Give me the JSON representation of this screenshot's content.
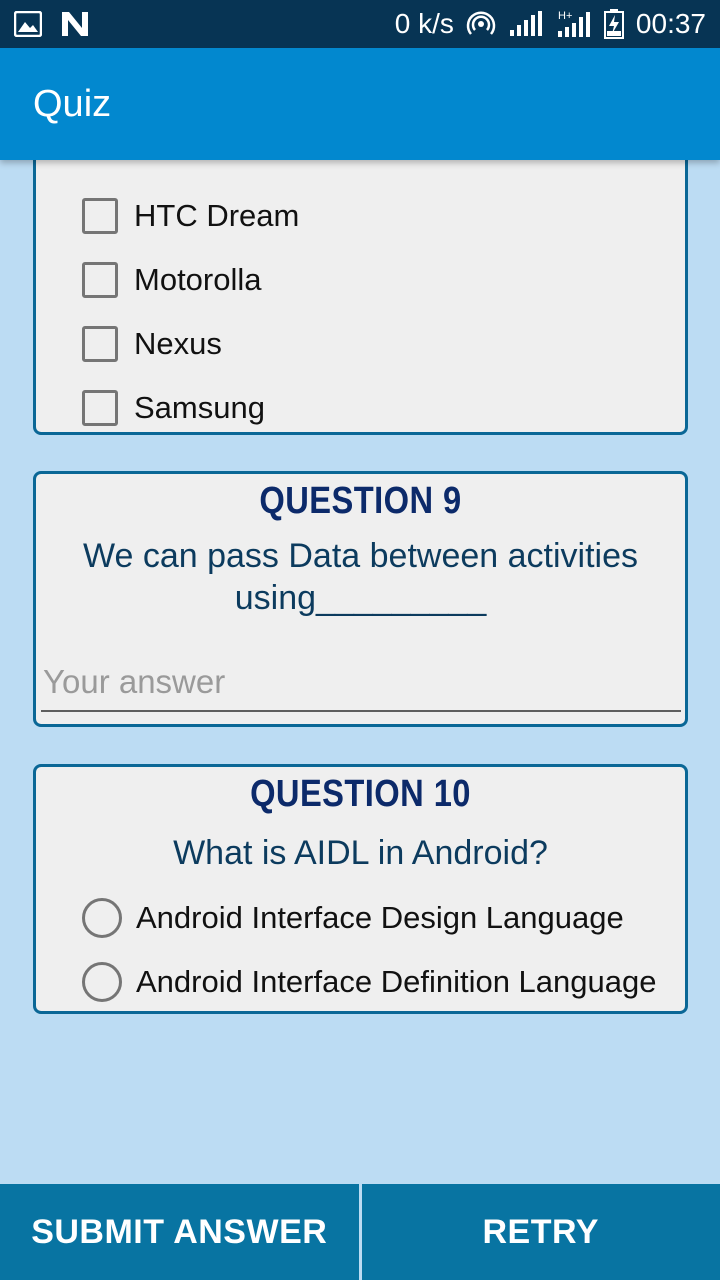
{
  "status_bar": {
    "speed": "0 k/s",
    "time": "00:37",
    "icons": [
      "image-icon",
      "n-logo-icon",
      "hotspot-icon",
      "signal-icon",
      "signal-hplus-icon",
      "battery-charging-icon"
    ]
  },
  "app_bar": {
    "title": "Quiz"
  },
  "question_8": {
    "options": [
      "HTC Dream",
      "Motorolla",
      "Nexus",
      "Samsung"
    ]
  },
  "question_9": {
    "title": "QUESTION 9",
    "text_line1": "We can pass Data between activities",
    "text_line2": "using_________",
    "answer_placeholder": "Your answer"
  },
  "question_10": {
    "title": "QUESTION 10",
    "text": "What is AIDL in Android?",
    "options": [
      "Android Interface Design Language",
      "Android Interface Definition Language"
    ]
  },
  "buttons": {
    "submit": "SUBMIT ANSWER",
    "retry": "RETRY"
  },
  "colors": {
    "background": "#bcdcf3",
    "status_bar": "#073454",
    "app_bar": "#0288cf",
    "card_border": "#0a6796",
    "title_text": "#0c2a6a",
    "button": "#0874a2"
  }
}
